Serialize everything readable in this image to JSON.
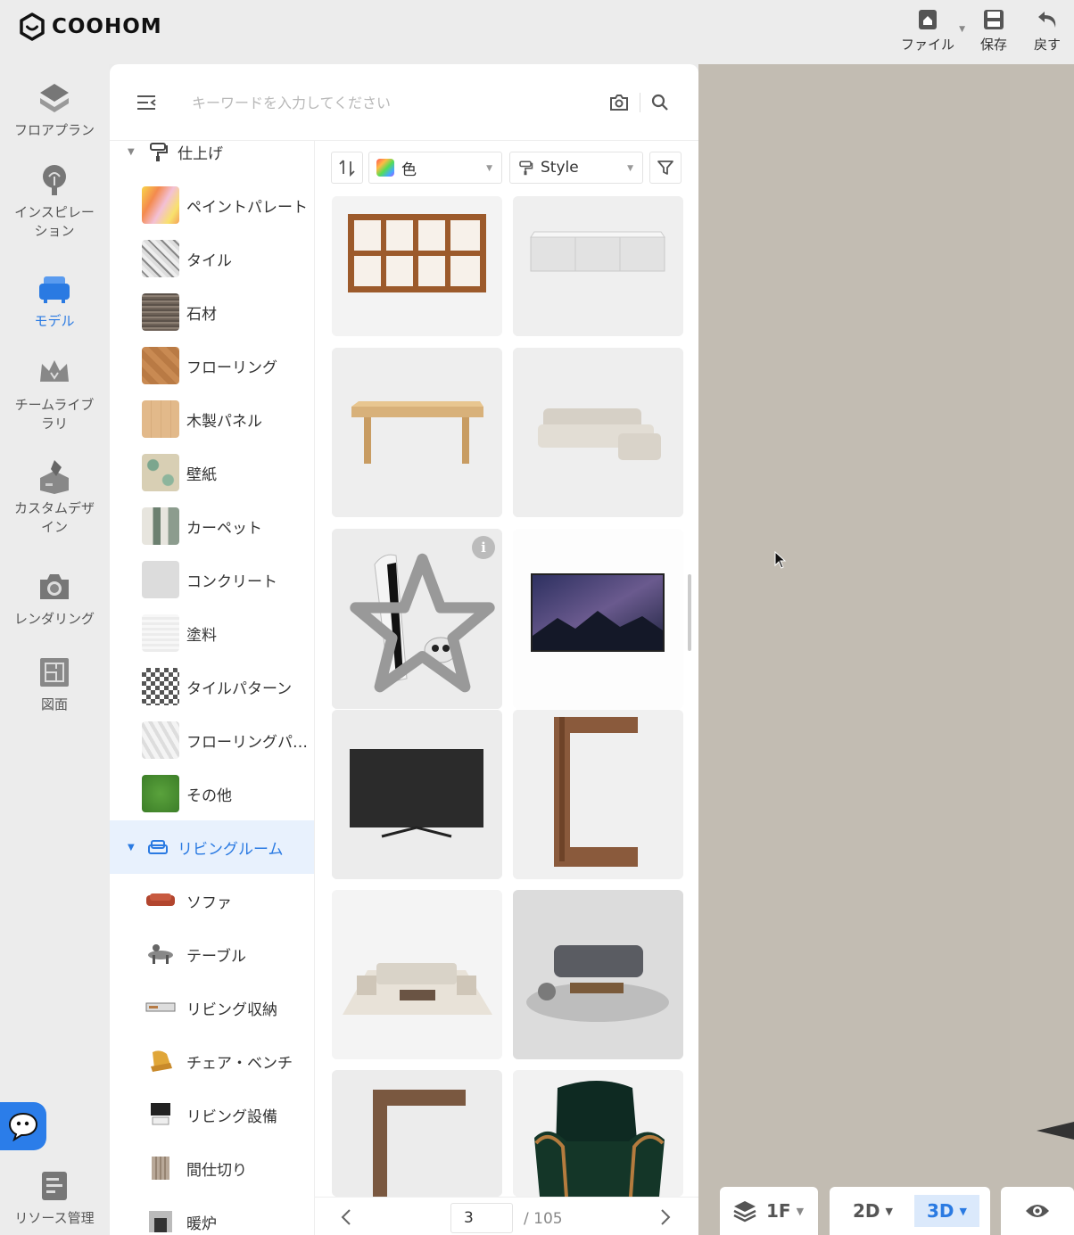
{
  "brand": {
    "name": "COOHOM"
  },
  "top_actions": {
    "file": "ファイル",
    "save": "保存",
    "undo": "戻す"
  },
  "left_nav": [
    {
      "label": "フロアプラン",
      "icon": "floorplan-icon"
    },
    {
      "label": "インスピレーション",
      "icon": "inspiration-icon"
    },
    {
      "label": "モデル",
      "icon": "model-sofa-icon",
      "active": true
    },
    {
      "label": "チームライブラリ",
      "icon": "crown-icon"
    },
    {
      "label": "カスタムデザイン",
      "icon": "custom-design-icon"
    },
    {
      "label": "レンダリング",
      "icon": "camera-icon"
    },
    {
      "label": "図面",
      "icon": "drawing-icon"
    },
    {
      "label": "リソース管理",
      "icon": "resource-icon"
    }
  ],
  "search": {
    "placeholder": "キーワードを入力してください"
  },
  "tree": {
    "finish_header": "仕上げ",
    "finish_items": [
      {
        "label": "ペイントパレート"
      },
      {
        "label": "タイル"
      },
      {
        "label": "石材"
      },
      {
        "label": "フローリング"
      },
      {
        "label": "木製パネル"
      },
      {
        "label": "壁紙"
      },
      {
        "label": "カーペット"
      },
      {
        "label": "コンクリート"
      },
      {
        "label": "塗料"
      },
      {
        "label": "タイルパターン"
      },
      {
        "label": "フローリングパ…"
      },
      {
        "label": "その他"
      }
    ],
    "living_header": "リビングルーム",
    "living_items": [
      {
        "label": "ソファ"
      },
      {
        "label": "テーブル"
      },
      {
        "label": "リビング収納"
      },
      {
        "label": "チェア・ベンチ"
      },
      {
        "label": "リビング設備"
      },
      {
        "label": "間仕切り"
      },
      {
        "label": "暖炉"
      }
    ]
  },
  "filters": {
    "color_label": "色",
    "style_label": "Style"
  },
  "products": [
    {
      "name": "bookshelf"
    },
    {
      "name": "glass-tv-stand"
    },
    {
      "name": "wooden-table"
    },
    {
      "name": "sectional-sofa"
    },
    {
      "name": "game-console"
    },
    {
      "name": "wall-tv"
    },
    {
      "name": "tv-monitor"
    },
    {
      "name": "c-side-table"
    },
    {
      "name": "living-set-light"
    },
    {
      "name": "living-set-dark"
    },
    {
      "name": "c-side-table-2"
    },
    {
      "name": "armchair"
    }
  ],
  "pagination": {
    "current": "3",
    "total": "/ 105"
  },
  "view_controls": {
    "floor": "1F",
    "view_2d": "2D",
    "view_3d": "3D"
  }
}
